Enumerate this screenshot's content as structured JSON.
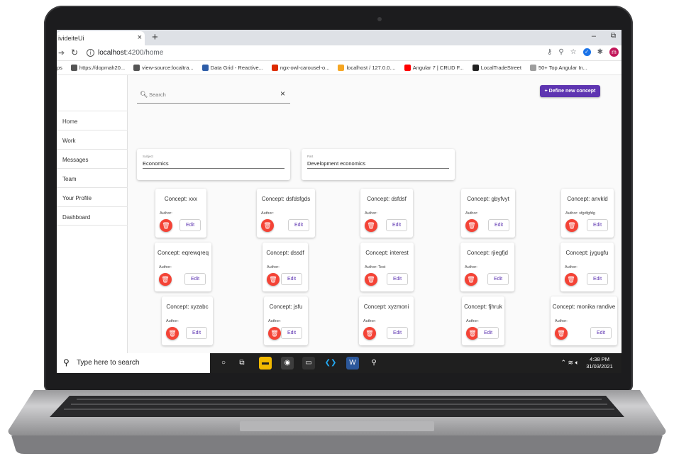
{
  "browser": {
    "tab_title": "ivideiteUi",
    "tab_close": "×",
    "new_tab": "+",
    "win_min": "–",
    "win_max": "⧉",
    "url_host": "localhost",
    "url_path": ":4200/home",
    "bookmarks": [
      {
        "label": "ps",
        "color": ""
      },
      {
        "label": "https://dopmah20...",
        "color": "#555555"
      },
      {
        "label": "view-source:localtra...",
        "color": "#555555"
      },
      {
        "label": "Data Grid - Reactive...",
        "color": "#2e5da8"
      },
      {
        "label": "ngx-owl-carousel-o...",
        "color": "#dd2c00"
      },
      {
        "label": "localhost / 127.0.0....",
        "color": "#f5a623"
      },
      {
        "label": "Angular 7 | CRUD F...",
        "color": "#ff0000"
      },
      {
        "label": "LocalTradeStreet",
        "color": "#222222"
      },
      {
        "label": "50+ Top Angular In...",
        "color": "#9e9e9e"
      }
    ]
  },
  "sidebar": {
    "items": [
      "Home",
      "Work",
      "Messages",
      "Team",
      "Your Profile",
      "Dashboard"
    ]
  },
  "search": {
    "placeholder": "Search",
    "clear": "×"
  },
  "define_button": "+ Define new concept",
  "subject": {
    "label": "Subject",
    "value": "Economics"
  },
  "part": {
    "label": "Part",
    "value": "Development economics"
  },
  "edit_label": "Edit",
  "concepts": [
    {
      "title": "Concept: xxx",
      "author": "Author:"
    },
    {
      "title": "Concept: dsfdsfgds",
      "author": "Author:"
    },
    {
      "title": "Concept: dsfdsf",
      "author": "Author:"
    },
    {
      "title": "Concept: gbyfvyt",
      "author": "Author:"
    },
    {
      "title": "Concept: anvkld",
      "author": "Author: sfgdfgfdg"
    },
    {
      "title": "Concept: eqrewqreq",
      "author": "Author:"
    },
    {
      "title": "Concept: dssdf",
      "author": "Author:"
    },
    {
      "title": "Concept: interest",
      "author": "Author: Test"
    },
    {
      "title": "Concept: rjiegfjd",
      "author": "Author:"
    },
    {
      "title": "Concept: jygugfu",
      "author": "Author:"
    },
    {
      "title": "Concept: xyzabc",
      "author": "Author:"
    },
    {
      "title": "Concept: jsfu",
      "author": "Author:"
    },
    {
      "title": "Concept: xyzmoni",
      "author": "Author:"
    },
    {
      "title": "Concept: fjhruk",
      "author": "Author:"
    },
    {
      "title": "Concept: monika randive",
      "author": "Author:"
    }
  ],
  "taskbar": {
    "search_text": "Type here to search",
    "time": "4:38 PM",
    "date": "31/03/2021",
    "avatar_letter": "m"
  },
  "colors": {
    "accent": "#5e35b1",
    "delete": "#f44336"
  }
}
